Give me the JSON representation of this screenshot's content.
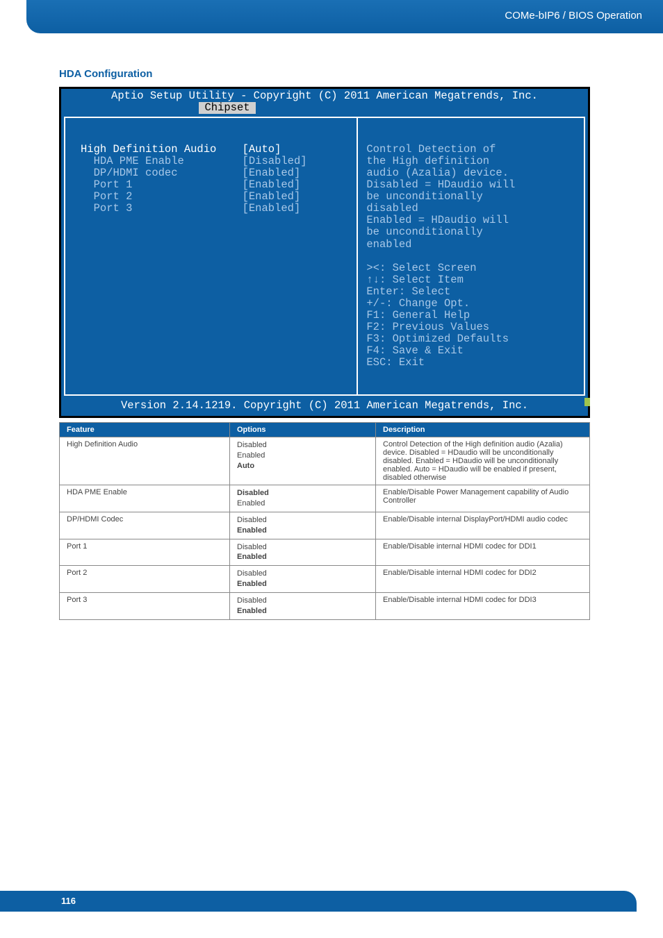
{
  "header": {
    "breadcrumb": "COMe-bIP6 / BIOS Operation"
  },
  "section_title": "HDA Configuration",
  "bios": {
    "title": "Aptio Setup Utility - Copyright (C) 2011 American Megatrends, Inc.",
    "tab": "Chipset",
    "left": {
      "r0l": "High Definition Audio",
      "r0v": "[Auto]",
      "r1l": "  HDA PME Enable",
      "r1v": "[Disabled]",
      "r2l": "  DP/HDMI codec",
      "r2v": "[Enabled]",
      "r3l": "  Port 1",
      "r3v": "[Enabled]",
      "r4l": "  Port 2",
      "r4v": "[Enabled]",
      "r5l": "  Port 3",
      "r5v": "[Enabled]"
    },
    "right": {
      "help": "Control Detection of\nthe High definition\naudio (Azalia) device.\nDisabled = HDaudio will\nbe unconditionally\ndisabled\nEnabled = HDaudio will\nbe unconditionally\nenabled",
      "keys": "><: Select Screen\n↑↓: Select Item\nEnter: Select\n+/-: Change Opt.\nF1: General Help\nF2: Previous Values\nF3: Optimized Defaults\nF4: Save & Exit\nESC: Exit"
    },
    "footer": "Version 2.14.1219. Copyright (C) 2011 American Megatrends, Inc."
  },
  "table": {
    "headers": {
      "c1": "Feature",
      "c2": "Options",
      "c3": "Description"
    },
    "rows": [
      {
        "feature": "High Definition Audio",
        "options": [
          {
            "text": "Disabled",
            "bold": false
          },
          {
            "text": "Enabled",
            "bold": false
          },
          {
            "text": "Auto",
            "bold": true
          }
        ],
        "desc": "Control Detection of the High definition audio (Azalia) device. Disabled = HDaudio will be unconditionally disabled. Enabled = HDaudio will be unconditionally enabled. Auto = HDaudio will be enabled if present, disabled otherwise"
      },
      {
        "feature": "HDA PME Enable",
        "options": [
          {
            "text": "Disabled",
            "bold": true
          },
          {
            "text": "Enabled",
            "bold": false
          }
        ],
        "desc": "Enable/Disable Power Management capability of Audio Controller"
      },
      {
        "feature": "DP/HDMI Codec",
        "options": [
          {
            "text": "Disabled",
            "bold": false
          },
          {
            "text": "Enabled",
            "bold": true
          }
        ],
        "desc": "Enable/Disable internal DisplayPort/HDMI audio codec"
      },
      {
        "feature": "Port 1",
        "options": [
          {
            "text": "Disabled",
            "bold": false
          },
          {
            "text": "Enabled",
            "bold": true
          }
        ],
        "desc": "Enable/Disable internal HDMI codec for DDI1"
      },
      {
        "feature": "Port 2",
        "options": [
          {
            "text": "Disabled",
            "bold": false
          },
          {
            "text": "Enabled",
            "bold": true
          }
        ],
        "desc": "Enable/Disable internal HDMI codec for DDI2"
      },
      {
        "feature": "Port 3",
        "options": [
          {
            "text": "Disabled",
            "bold": false
          },
          {
            "text": "Enabled",
            "bold": true
          }
        ],
        "desc": "Enable/Disable internal HDMI codec for DDI3"
      }
    ]
  },
  "page_number": "116"
}
